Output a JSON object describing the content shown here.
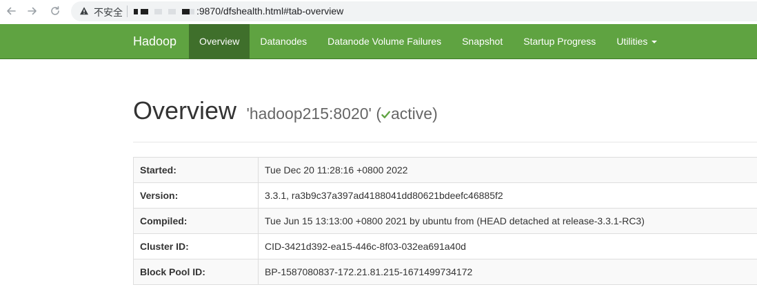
{
  "browser": {
    "insecure_label": "不安全",
    "url_suffix": ":9870/dfshealth.html#tab-overview"
  },
  "navbar": {
    "brand": "Hadoop",
    "items": [
      {
        "label": "Overview",
        "active": true
      },
      {
        "label": "Datanodes"
      },
      {
        "label": "Datanode Volume Failures"
      },
      {
        "label": "Snapshot"
      },
      {
        "label": "Startup Progress"
      },
      {
        "label": "Utilities"
      }
    ],
    "accent_color": "#5fa341",
    "active_color": "#3f6f2b"
  },
  "header": {
    "title": "Overview",
    "host": "'hadoop215:8020' (",
    "state": "active",
    "close_paren": ")",
    "check_color": "#5fa341"
  },
  "overview": {
    "rows": [
      {
        "label": "Started:",
        "value": "Tue Dec 20 11:28:16 +0800 2022"
      },
      {
        "label": "Version:",
        "value": "3.3.1, ra3b9c37a397ad4188041dd80621bdeefc46885f2"
      },
      {
        "label": "Compiled:",
        "value": "Tue Jun 15 13:13:00 +0800 2021 by ubuntu from (HEAD detached at release-3.3.1-RC3)"
      },
      {
        "label": "Cluster ID:",
        "value": "CID-3421d392-ea15-446c-8f03-032ea691a40d"
      },
      {
        "label": "Block Pool ID:",
        "value": "BP-1587080837-172.21.81.215-1671499734172"
      }
    ]
  }
}
